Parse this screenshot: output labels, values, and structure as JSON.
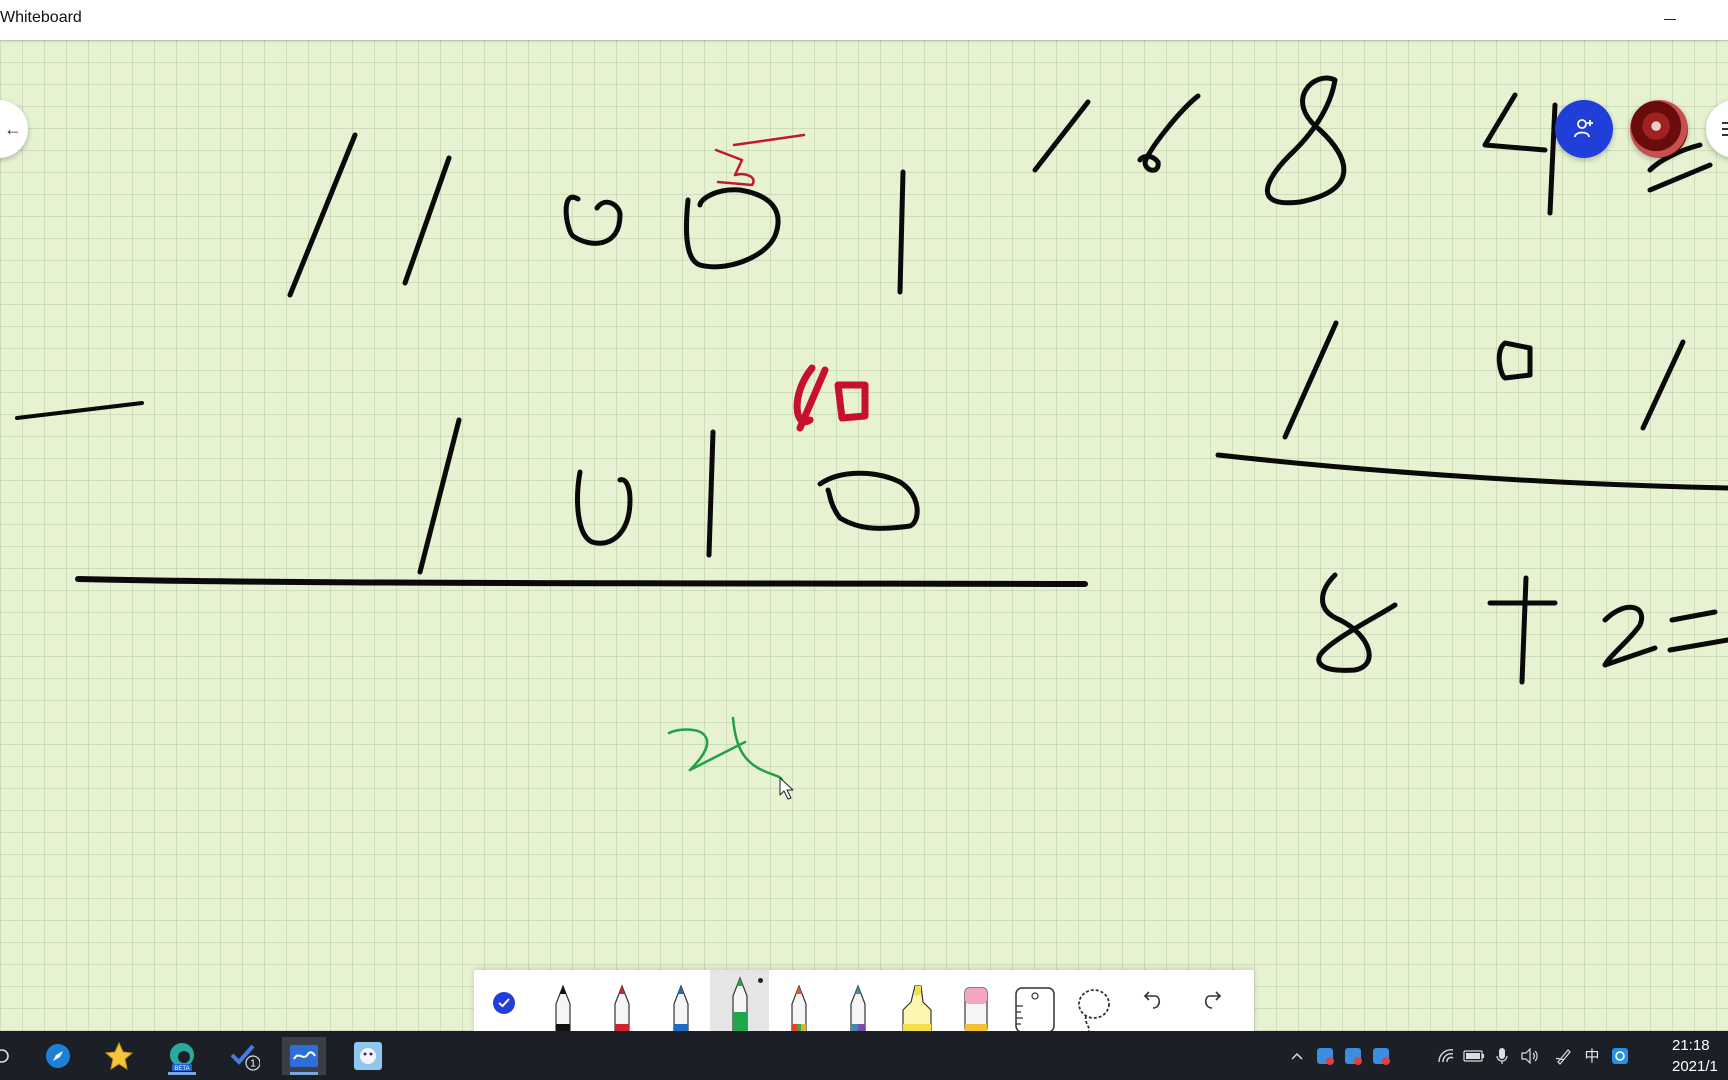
{
  "window": {
    "title": "Whiteboard",
    "minimize_label": "—"
  },
  "floating": {
    "back_label": "←",
    "invite_icon": "add-person-icon",
    "avatar_icon": "user-avatar"
  },
  "toolbar": {
    "tools": [
      {
        "name": "select-tool",
        "icon": "check-icon"
      },
      {
        "name": "black-pen",
        "color": "#111111"
      },
      {
        "name": "red-pen",
        "color": "#d1202e"
      },
      {
        "name": "blue-pen",
        "color": "#1a6cc4"
      },
      {
        "name": "green-pen",
        "color": "#1fa84a",
        "selected": true
      },
      {
        "name": "rainbow-pen",
        "color": "#e05a2a"
      },
      {
        "name": "galaxy-pen",
        "color": "#3a8fb0"
      },
      {
        "name": "highlighter",
        "color": "#f3e04a"
      },
      {
        "name": "eraser",
        "color": "#f4a6c0"
      },
      {
        "name": "ruler",
        "icon": "ruler-icon"
      },
      {
        "name": "lasso",
        "icon": "lasso-icon"
      },
      {
        "name": "undo",
        "icon": "undo-icon"
      },
      {
        "name": "redo",
        "icon": "redo-icon"
      }
    ]
  },
  "taskbar": {
    "apps": [
      {
        "name": "safari-app",
        "icon": "compass-icon"
      },
      {
        "name": "star-app",
        "icon": "star-icon"
      },
      {
        "name": "edge-beta-app",
        "icon": "edge-icon"
      },
      {
        "name": "todo-app",
        "icon": "todo-icon",
        "badge": "1"
      },
      {
        "name": "whiteboard-app",
        "icon": "whiteboard-icon",
        "active": true
      },
      {
        "name": "wallpaper-app",
        "icon": "wallpaper-icon"
      }
    ],
    "ime": "中",
    "clock_time": "21:18",
    "clock_date": "2021/1"
  }
}
